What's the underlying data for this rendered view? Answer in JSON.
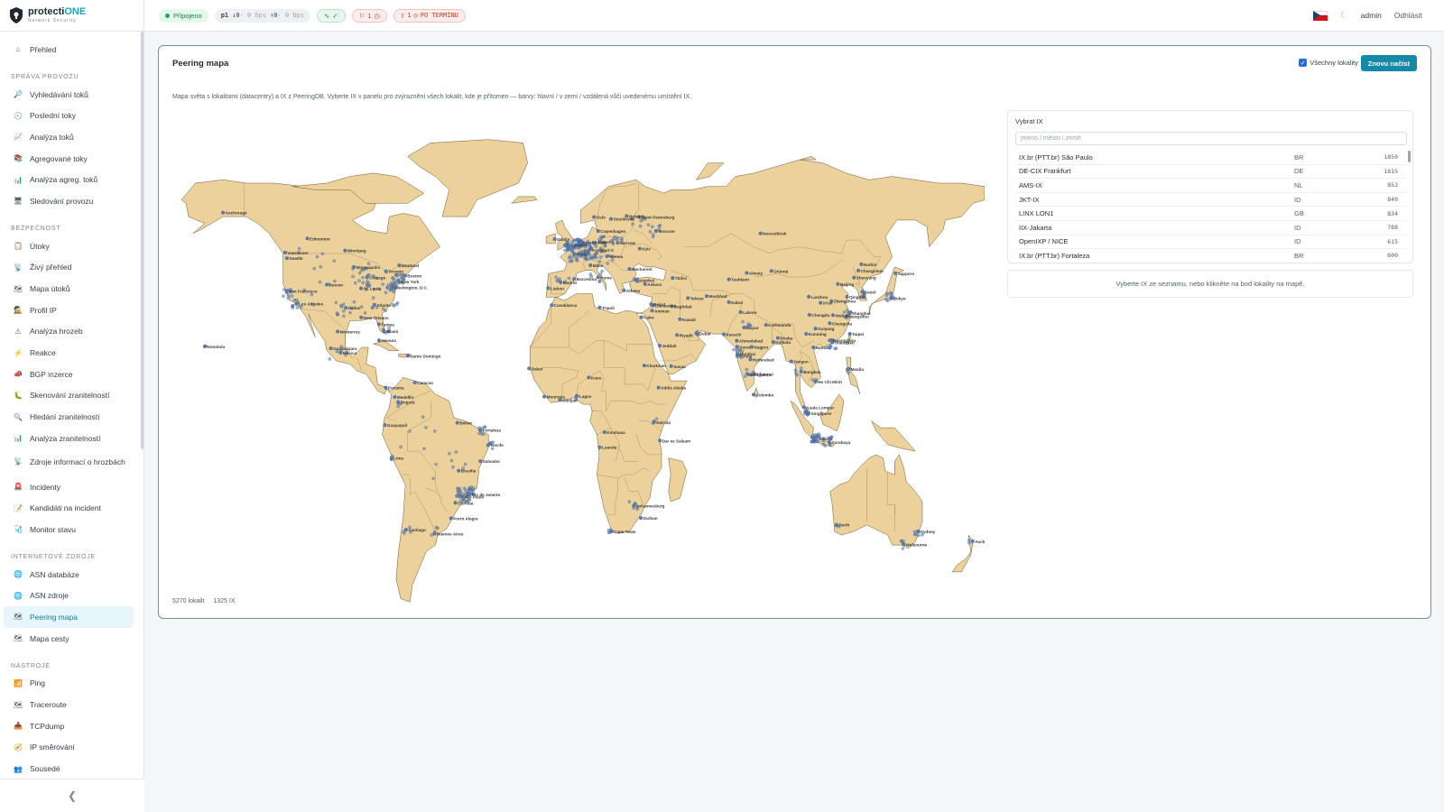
{
  "brand": {
    "name_main": "protecti",
    "name_accent": "ONE",
    "subtitle": "Network Security"
  },
  "header": {
    "status": "Připojeno",
    "traffic_probe": "p1",
    "traffic_in": "↓0",
    "traffic_in_unit": "· 0 bps",
    "traffic_out": "↑0",
    "traffic_out_unit": "· 0 bps",
    "health": "✓",
    "flags": "1",
    "overdue_count": "1",
    "overdue_text": "PO TERMÍNU",
    "user": "admin",
    "logout": "Odhlásit"
  },
  "sidebar": {
    "items": [
      {
        "type": "item",
        "label": "Přehled",
        "icon": "home-icon",
        "glyph": "⌂"
      },
      {
        "type": "section",
        "label": "SPRÁVA PROVOZU"
      },
      {
        "type": "item",
        "label": "Vyhledávání toků",
        "icon": "search-icon",
        "glyph": "🔎"
      },
      {
        "type": "item",
        "label": "Poslední toky",
        "icon": "clock-icon",
        "glyph": "🕘"
      },
      {
        "type": "item",
        "label": "Analýza toků",
        "icon": "chart-up-icon",
        "glyph": "📈"
      },
      {
        "type": "item",
        "label": "Agregované toky",
        "icon": "stack-icon",
        "glyph": "📚"
      },
      {
        "type": "item",
        "label": "Analýza agreg. toků",
        "icon": "bar-chart-icon",
        "glyph": "📊"
      },
      {
        "type": "item",
        "label": "Sledování provozu",
        "icon": "monitor-icon",
        "glyph": "🖥"
      },
      {
        "type": "section",
        "label": "BEZPEČNOST"
      },
      {
        "type": "item",
        "label": "Útoky",
        "icon": "clipboard-icon",
        "glyph": "📋"
      },
      {
        "type": "item",
        "label": "Živý přehled",
        "icon": "antenna-icon",
        "glyph": "📡"
      },
      {
        "type": "item",
        "label": "Mapa útoků",
        "icon": "map-icon",
        "glyph": "🗺"
      },
      {
        "type": "item",
        "label": "Profil IP",
        "icon": "detective-icon",
        "glyph": "🕵"
      },
      {
        "type": "item",
        "label": "Analýza hrozeb",
        "icon": "warning-icon",
        "glyph": "⚠"
      },
      {
        "type": "item",
        "label": "Reakce",
        "icon": "lightning-icon",
        "glyph": "⚡"
      },
      {
        "type": "item",
        "label": "BGP inzerce",
        "icon": "megaphone-icon",
        "glyph": "📣"
      },
      {
        "type": "item",
        "label": "Skenování zranitelností",
        "icon": "bug-icon",
        "glyph": "🐛"
      },
      {
        "type": "item",
        "label": "Hledání zranitelností",
        "icon": "magnifier-icon",
        "glyph": "🔍"
      },
      {
        "type": "item",
        "label": "Analýza zranitelností",
        "icon": "bar-chart-icon",
        "glyph": "📊"
      },
      {
        "type": "item",
        "label": "Zdroje informací o hrozbách",
        "icon": "satellite-icon",
        "glyph": "📡",
        "tall": true
      },
      {
        "type": "item",
        "label": "Incidenty",
        "icon": "siren-icon",
        "glyph": "🚨"
      },
      {
        "type": "item",
        "label": "Kandidáti na incident",
        "icon": "memo-icon",
        "glyph": "📝"
      },
      {
        "type": "item",
        "label": "Monitor stavu",
        "icon": "stethoscope-icon",
        "glyph": "🩺"
      },
      {
        "type": "section",
        "label": "INTERNETOVÉ ZDROJE"
      },
      {
        "type": "item",
        "label": "ASN databáze",
        "icon": "globe-icon",
        "glyph": "🌐"
      },
      {
        "type": "item",
        "label": "ASN zdroje",
        "icon": "globe-icon",
        "glyph": "🌐"
      },
      {
        "type": "item",
        "label": "Peering mapa",
        "icon": "map-icon",
        "glyph": "🗺",
        "active": true
      },
      {
        "type": "item",
        "label": "Mapa cesty",
        "icon": "map-icon",
        "glyph": "🗺"
      },
      {
        "type": "section",
        "label": "NÁSTROJE"
      },
      {
        "type": "item",
        "label": "Ping",
        "icon": "signal-icon",
        "glyph": "📶"
      },
      {
        "type": "item",
        "label": "Traceroute",
        "icon": "route-map-icon",
        "glyph": "🗺"
      },
      {
        "type": "item",
        "label": "TCPdump",
        "icon": "inbox-icon",
        "glyph": "📥"
      },
      {
        "type": "item",
        "label": "IP směrování",
        "icon": "compass-icon",
        "glyph": "🧭"
      },
      {
        "type": "item",
        "label": "Sousedé",
        "icon": "people-icon",
        "glyph": "👥"
      }
    ],
    "collapse_glyph": "❮"
  },
  "card": {
    "title": "Peering mapa",
    "all_locations_label": "Všechny lokality",
    "reload_label": "Znovu načíst",
    "description": "Mapa světa s lokalitami (datacentry) a IX z PeeringDB. Vyberte IX v panelu pro zvýraznění všech lokalit, kde je přítomen — barvy: hlavní / v zemi / vzdálená vůči uvedenému umístění IX.",
    "stats_locations": "5270 lokalit",
    "stats_ix": "1325 IX"
  },
  "ix_panel": {
    "label": "Vybrat IX",
    "search_placeholder": "jméno / město / země",
    "rows": [
      {
        "name": "IX.br (PTT.br) São Paulo",
        "country": "BR",
        "count": "1850"
      },
      {
        "name": "DE-CIX Frankfurt",
        "country": "DE",
        "count": "1815"
      },
      {
        "name": "AMS-IX",
        "country": "NL",
        "count": "852"
      },
      {
        "name": "JKT-IX",
        "country": "ID",
        "count": "840"
      },
      {
        "name": "LINX LON1",
        "country": "GB",
        "count": "834"
      },
      {
        "name": "IIX-Jakarta",
        "country": "ID",
        "count": "788"
      },
      {
        "name": "OpenIXP / NICE",
        "country": "ID",
        "count": "615"
      },
      {
        "name": "IX.br (PTT.br) Fortaleza",
        "country": "BR",
        "count": "600"
      }
    ],
    "hint": "Vyberte IX ze seznamu, nebo klikněte na bod lokality na mapě."
  },
  "map": {
    "land_color": "#ecd29a",
    "border_color": "#6b5a3a",
    "dot_color": "#5b7fb8",
    "cities": [
      {
        "name": "Anchorage",
        "lon": -150,
        "lat": 61.2
      },
      {
        "name": "Edmonton",
        "lon": -113.5,
        "lat": 53.5
      },
      {
        "name": "Vancouver",
        "lon": -123.1,
        "lat": 49.3
      },
      {
        "name": "Seattle",
        "lon": -122.3,
        "lat": 47.6
      },
      {
        "name": "Winnipeg",
        "lon": -97.1,
        "lat": 49.9
      },
      {
        "name": "Montreal",
        "lon": -73.6,
        "lat": 45.5
      },
      {
        "name": "Toronto",
        "lon": -79.4,
        "lat": 43.7
      },
      {
        "name": "Boston",
        "lon": -71.1,
        "lat": 42.4
      },
      {
        "name": "New York",
        "lon": -74,
        "lat": 40.7
      },
      {
        "name": "Washington, D.C.",
        "lon": -77,
        "lat": 38.9
      },
      {
        "name": "Minneapolis",
        "lon": -93.3,
        "lat": 44.98
      },
      {
        "name": "Chicago",
        "lon": -87.6,
        "lat": 41.9
      },
      {
        "name": "Denver",
        "lon": -105,
        "lat": 39.7
      },
      {
        "name": "San Francisco",
        "lon": -122.4,
        "lat": 37.8
      },
      {
        "name": "Los Angeles",
        "lon": -118.2,
        "lat": 34
      },
      {
        "name": "St. Louis",
        "lon": -90.2,
        "lat": 38.6
      },
      {
        "name": "Dallas",
        "lon": -96.8,
        "lat": 32.8
      },
      {
        "name": "Atlanta",
        "lon": -84.4,
        "lat": 33.7
      },
      {
        "name": "New Orleans",
        "lon": -90.1,
        "lat": 29.95
      },
      {
        "name": "Tampa",
        "lon": -82.5,
        "lat": 27.9
      },
      {
        "name": "Miami",
        "lon": -80.2,
        "lat": 25.8
      },
      {
        "name": "Monterrey",
        "lon": -100.3,
        "lat": 25.7
      },
      {
        "name": "Havana",
        "lon": -82.4,
        "lat": 23.1
      },
      {
        "name": "Honolulu",
        "lon": -157.9,
        "lat": 21.3
      },
      {
        "name": "Guadalajara",
        "lon": -103.3,
        "lat": 20.7
      },
      {
        "name": "Mexico",
        "lon": -99.1,
        "lat": 19.4
      },
      {
        "name": "Santo Domingo",
        "lon": -69.9,
        "lat": 18.5
      },
      {
        "name": "Panama",
        "lon": -79.5,
        "lat": 9
      },
      {
        "name": "Caracas",
        "lon": -66.9,
        "lat": 10.5
      },
      {
        "name": "Medellín",
        "lon": -75.6,
        "lat": 6.2
      },
      {
        "name": "Bogotá",
        "lon": -74.1,
        "lat": 4.7
      },
      {
        "name": "Guayaquil",
        "lon": -79.9,
        "lat": -2.2
      },
      {
        "name": "Belém",
        "lon": -48.5,
        "lat": -1.5
      },
      {
        "name": "Fortaleza",
        "lon": -38.5,
        "lat": -3.7
      },
      {
        "name": "Recife",
        "lon": -34.9,
        "lat": -8.05
      },
      {
        "name": "Lima",
        "lon": -77,
        "lat": -12
      },
      {
        "name": "Salvador",
        "lon": -38.5,
        "lat": -12.97
      },
      {
        "name": "Brasília",
        "lon": -47.9,
        "lat": -15.8
      },
      {
        "name": "Rio de Janeiro",
        "lon": -43.2,
        "lat": -22.9
      },
      {
        "name": "São Paulo",
        "lon": -46.6,
        "lat": -23.5
      },
      {
        "name": "Curitiba",
        "lon": -49.3,
        "lat": -25.4
      },
      {
        "name": "Porto Alegre",
        "lon": -51.2,
        "lat": -30
      },
      {
        "name": "Santiago",
        "lon": -70.7,
        "lat": -33.4
      },
      {
        "name": "Buenos Aires",
        "lon": -58.4,
        "lat": -34.6
      },
      {
        "name": "Oslo",
        "lon": 10.75,
        "lat": 59.9
      },
      {
        "name": "Stockholm",
        "lon": 18.1,
        "lat": 59.3
      },
      {
        "name": "Helsinki",
        "lon": 24.9,
        "lat": 60.2
      },
      {
        "name": "Saint Petersburg",
        "lon": 30.3,
        "lat": 59.9
      },
      {
        "name": "Moscow",
        "lon": 37.6,
        "lat": 55.75
      },
      {
        "name": "Copenhagen",
        "lon": 12.6,
        "lat": 55.7
      },
      {
        "name": "Dublin",
        "lon": -6.3,
        "lat": 53.3
      },
      {
        "name": "London",
        "lon": -0.1,
        "lat": 51.5
      },
      {
        "name": "Amsterdam",
        "lon": 4.9,
        "lat": 52.4
      },
      {
        "name": "Berlin",
        "lon": 13.4,
        "lat": 52.5
      },
      {
        "name": "Warsaw",
        "lon": 21,
        "lat": 52.2
      },
      {
        "name": "Kyiv",
        "lon": 30.5,
        "lat": 50.45
      },
      {
        "name": "Frankfurt",
        "lon": 8.7,
        "lat": 50.1
      },
      {
        "name": "Paris",
        "lon": 2.35,
        "lat": 48.9
      },
      {
        "name": "Vienna",
        "lon": 16.4,
        "lat": 48.2
      },
      {
        "name": "Bucharest",
        "lon": 26.1,
        "lat": 44.4
      },
      {
        "name": "Milan",
        "lon": 9.2,
        "lat": 45.5
      },
      {
        "name": "Madrid",
        "lon": -3.7,
        "lat": 40.4
      },
      {
        "name": "Lisbon",
        "lon": -9.1,
        "lat": 38.7
      },
      {
        "name": "Barcelona",
        "lon": 2.2,
        "lat": 41.4
      },
      {
        "name": "Rome",
        "lon": 12.5,
        "lat": 41.9
      },
      {
        "name": "Istanbul",
        "lon": 29,
        "lat": 41
      },
      {
        "name": "Ankara",
        "lon": 32.9,
        "lat": 39.9
      },
      {
        "name": "Athens",
        "lon": 23.7,
        "lat": 38
      },
      {
        "name": "Tashkent",
        "lon": 69.2,
        "lat": 41.3
      },
      {
        "name": "Tbilisi",
        "lon": 44.8,
        "lat": 41.7
      },
      {
        "name": "Casablanca",
        "lon": -7.6,
        "lat": 33.6
      },
      {
        "name": "Tripoli",
        "lon": 13.2,
        "lat": 32.9
      },
      {
        "name": "Cairo",
        "lon": 31.2,
        "lat": 30
      },
      {
        "name": "Amman",
        "lon": 35.9,
        "lat": 31.95
      },
      {
        "name": "Damascus",
        "lon": 36.3,
        "lat": 33.5
      },
      {
        "name": "Beirut",
        "lon": 35.5,
        "lat": 33.9
      },
      {
        "name": "Baghdad",
        "lon": 44.4,
        "lat": 33.3
      },
      {
        "name": "Tehran",
        "lon": 51.4,
        "lat": 35.7
      },
      {
        "name": "Kuwait",
        "lon": 47.98,
        "lat": 29.4
      },
      {
        "name": "Riyadh",
        "lon": 46.7,
        "lat": 24.7
      },
      {
        "name": "Dubai",
        "lon": 55.3,
        "lat": 25.2
      },
      {
        "name": "Jeddah",
        "lon": 39.2,
        "lat": 21.5
      },
      {
        "name": "Mashhad",
        "lon": 59.6,
        "lat": 36.3
      },
      {
        "name": "Kabul",
        "lon": 69.2,
        "lat": 34.5
      },
      {
        "name": "Lahore",
        "lon": 74.3,
        "lat": 31.5
      },
      {
        "name": "Karachi",
        "lon": 67,
        "lat": 24.9
      },
      {
        "name": "Jaipur",
        "lon": 75.8,
        "lat": 26.9
      },
      {
        "name": "Ahmedabad",
        "lon": 72.6,
        "lat": 23
      },
      {
        "name": "Surat",
        "lon": 72.8,
        "lat": 21.2
      },
      {
        "name": "Mumbai",
        "lon": 72.9,
        "lat": 19.1
      },
      {
        "name": "Pune",
        "lon": 73.9,
        "lat": 18.5
      },
      {
        "name": "Hyderabad",
        "lon": 78.5,
        "lat": 17.4
      },
      {
        "name": "Chennai",
        "lon": 80.3,
        "lat": 13.1
      },
      {
        "name": "Bengaluru",
        "lon": 77.6,
        "lat": 12.97
      },
      {
        "name": "Colombo",
        "lon": 79.9,
        "lat": 6.9
      },
      {
        "name": "Kathmandu",
        "lon": 85.3,
        "lat": 27.7
      },
      {
        "name": "Dhaka",
        "lon": 90.4,
        "lat": 23.8
      },
      {
        "name": "Kolkata",
        "lon": 88.4,
        "lat": 22.6
      },
      {
        "name": "Nagpur",
        "lon": 79.1,
        "lat": 21.1
      },
      {
        "name": "Kunming",
        "lon": 102.7,
        "lat": 25
      },
      {
        "name": "Chengdu",
        "lon": 104.1,
        "lat": 30.7
      },
      {
        "name": "Lanzhou",
        "lon": 103.8,
        "lat": 36.1
      },
      {
        "name": "Xi'an",
        "lon": 108.9,
        "lat": 34.3
      },
      {
        "name": "Beijing",
        "lon": 116.4,
        "lat": 39.9
      },
      {
        "name": "Shenyang",
        "lon": 123.4,
        "lat": 41.8
      },
      {
        "name": "Harbin",
        "lon": 126.6,
        "lat": 45.8
      },
      {
        "name": "Changchun",
        "lon": 125.3,
        "lat": 43.9
      },
      {
        "name": "Qingdao",
        "lon": 120.4,
        "lat": 36.1
      },
      {
        "name": "Zhengzhou",
        "lon": 113.6,
        "lat": 34.8
      },
      {
        "name": "Wuhan",
        "lon": 114.3,
        "lat": 30.6
      },
      {
        "name": "Shanghai",
        "lon": 121.5,
        "lat": 31.2
      },
      {
        "name": "Hangzhou",
        "lon": 120.2,
        "lat": 30.3
      },
      {
        "name": "Changsha",
        "lon": 112.9,
        "lat": 28.2
      },
      {
        "name": "Guiyang",
        "lon": 106.7,
        "lat": 26.6
      },
      {
        "name": "Guangzhou",
        "lon": 113.3,
        "lat": 23.1
      },
      {
        "name": "Shenzhen",
        "lon": 114.1,
        "lat": 22.5
      },
      {
        "name": "Taipei",
        "lon": 121.6,
        "lat": 25
      },
      {
        "name": "Seoul",
        "lon": 127,
        "lat": 37.6
      },
      {
        "name": "Tokyo",
        "lon": 139.7,
        "lat": 35.7
      },
      {
        "name": "Sapporo",
        "lon": 141.35,
        "lat": 43.1
      },
      {
        "name": "Ürümqi",
        "lon": 87.6,
        "lat": 43.8
      },
      {
        "name": "Almaty",
        "lon": 76.9,
        "lat": 43.2
      },
      {
        "name": "Novosibirsk",
        "lon": 82.9,
        "lat": 55
      },
      {
        "name": "Yangon",
        "lon": 96.2,
        "lat": 16.8
      },
      {
        "name": "Bangkok",
        "lon": 100.5,
        "lat": 13.75
      },
      {
        "name": "Hanoi",
        "lon": 105.8,
        "lat": 21
      },
      {
        "name": "Ho Chi Minh",
        "lon": 106.7,
        "lat": 10.8
      },
      {
        "name": "Manila",
        "lon": 121,
        "lat": 14.6
      },
      {
        "name": "Kuala Lumpur",
        "lon": 101.7,
        "lat": 3.1
      },
      {
        "name": "Singapore",
        "lon": 103.8,
        "lat": 1.35
      },
      {
        "name": "Jakarta",
        "lon": 106.8,
        "lat": -6.2
      },
      {
        "name": "Surabaya",
        "lon": 112.75,
        "lat": -7.25
      },
      {
        "name": "Lagos",
        "lon": 3.4,
        "lat": 6.5
      },
      {
        "name": "Kano",
        "lon": 8.5,
        "lat": 12
      },
      {
        "name": "Khartoum",
        "lon": 32.5,
        "lat": 15.6
      },
      {
        "name": "Sanaa",
        "lon": 44.2,
        "lat": 15.4
      },
      {
        "name": "Addis Ababa",
        "lon": 38.7,
        "lat": 9
      },
      {
        "name": "Dakar",
        "lon": -17.4,
        "lat": 14.7
      },
      {
        "name": "Monrovia",
        "lon": -10.8,
        "lat": 6.3
      },
      {
        "name": "Abidjan",
        "lon": -4,
        "lat": 5.3
      },
      {
        "name": "Nairobi",
        "lon": 36.8,
        "lat": -1.3
      },
      {
        "name": "Kinshasa",
        "lon": 15.3,
        "lat": -4.3
      },
      {
        "name": "Luanda",
        "lon": 13.2,
        "lat": -8.8
      },
      {
        "name": "Dar es Salaam",
        "lon": 39.3,
        "lat": -6.8
      },
      {
        "name": "Johannesburg",
        "lon": 28,
        "lat": -26.2
      },
      {
        "name": "Durban",
        "lon": 31,
        "lat": -29.9
      },
      {
        "name": "Cape Town",
        "lon": 18.4,
        "lat": -33.9
      },
      {
        "name": "Perth",
        "lon": 115.9,
        "lat": -31.95
      },
      {
        "name": "Sydney",
        "lon": 151.2,
        "lat": -33.9
      },
      {
        "name": "Melbourne",
        "lon": 144.96,
        "lat": -37.8
      },
      {
        "name": "Auckland",
        "lon": 174.8,
        "lat": -36.85
      }
    ]
  }
}
